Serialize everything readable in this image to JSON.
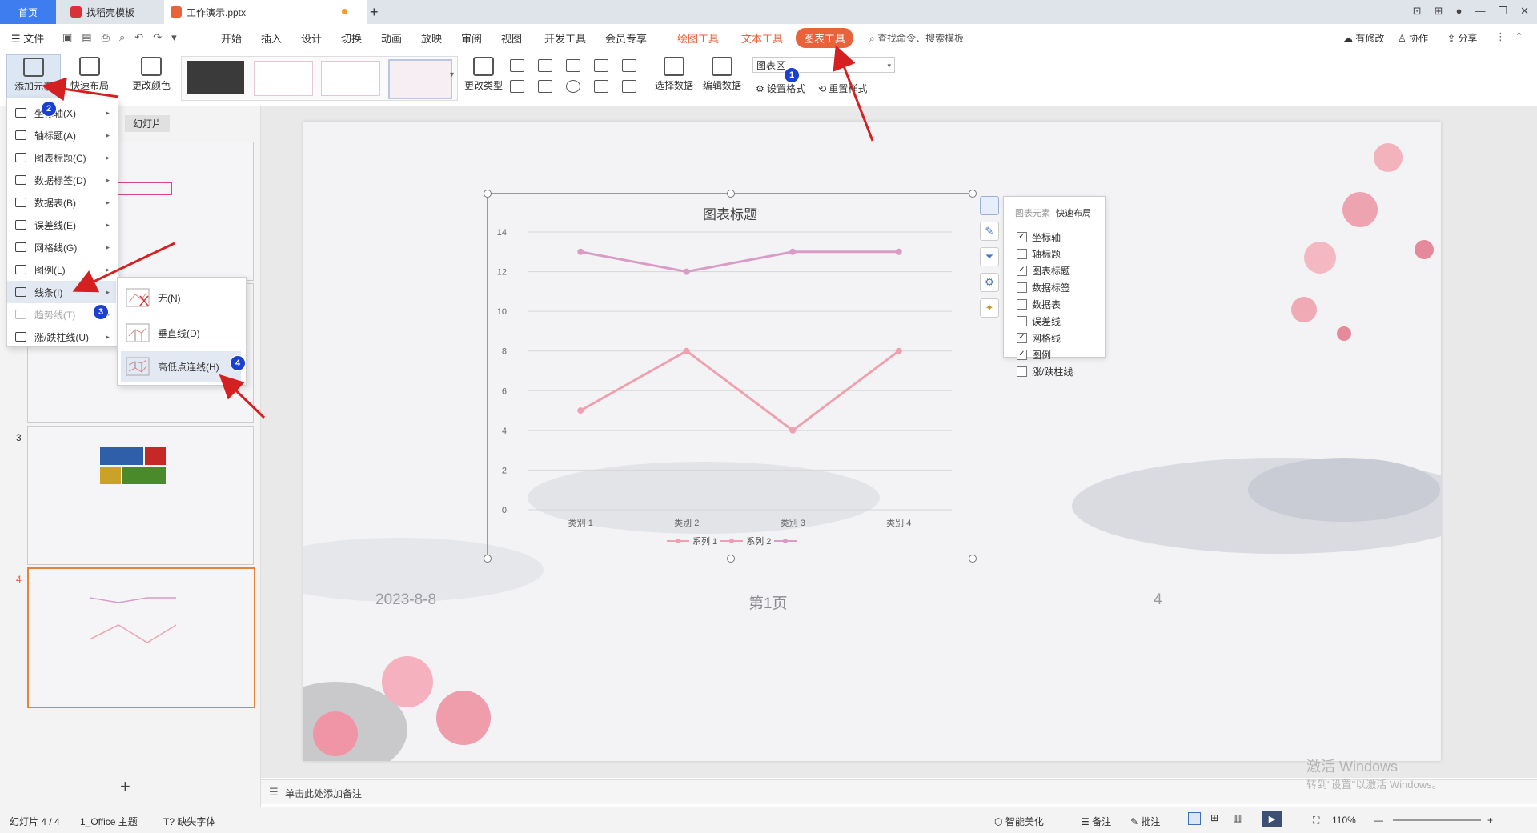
{
  "tabs": {
    "home": "首页",
    "template": "找稻壳模板",
    "doc": "工作演示.pptx",
    "new_tab": "+"
  },
  "menubar": {
    "file": "文件",
    "items": [
      "开始",
      "插入",
      "设计",
      "切换",
      "动画",
      "放映",
      "审阅",
      "视图",
      "开发工具",
      "会员专享"
    ],
    "tool_drawing": "绘图工具",
    "tool_text": "文本工具",
    "tool_chart": "图表工具",
    "search": "查找命令、搜索模板",
    "changes": "有修改",
    "collab": "协作",
    "share": "分享"
  },
  "ribbon": {
    "add_element": "添加元素",
    "quick_layout": "快速布局",
    "change_color": "更改颜色",
    "change_type": "更改类型",
    "select_data": "选择数据",
    "edit_data": "编辑数据",
    "chart_area_select": "图表区",
    "set_format": "设置格式",
    "reset_style": "重置样式"
  },
  "leftpane": {
    "slides_tab": "幻灯片",
    "slide3_num": "3",
    "slide4_num": "4",
    "add_slide": "+"
  },
  "add_element_menu": {
    "items": [
      {
        "label": "坐标轴(X)",
        "enabled": true
      },
      {
        "label": "轴标题(A)",
        "enabled": true
      },
      {
        "label": "图表标题(C)",
        "enabled": true
      },
      {
        "label": "数据标签(D)",
        "enabled": true
      },
      {
        "label": "数据表(B)",
        "enabled": true
      },
      {
        "label": "误差线(E)",
        "enabled": true
      },
      {
        "label": "网格线(G)",
        "enabled": true
      },
      {
        "label": "图例(L)",
        "enabled": true
      },
      {
        "label": "线条(I)",
        "enabled": true
      },
      {
        "label": "趋势线(T)",
        "enabled": false
      },
      {
        "label": "涨/跌柱线(U)",
        "enabled": true
      }
    ]
  },
  "lines_submenu": {
    "none": "无(N)",
    "drop_lines": "垂直线(D)",
    "high_low": "高低点连线(H)"
  },
  "badges": [
    "1",
    "2",
    "3",
    "4"
  ],
  "slide": {
    "date": "2023-8-8",
    "page": "第1页",
    "number": "4"
  },
  "chart_data": {
    "type": "line",
    "title": "图表标题",
    "categories": [
      "类别 1",
      "类别 2",
      "类别 3",
      "类别 4"
    ],
    "series": [
      {
        "name": "系列 1",
        "values": [
          5,
          8,
          4,
          8
        ],
        "color": "#f0a1b0"
      },
      {
        "name": "系列 2",
        "values": [
          13,
          12,
          13,
          13
        ],
        "color": "#d99cc6"
      }
    ],
    "ylim": [
      0,
      14
    ],
    "yticks": [
      0,
      2,
      4,
      6,
      8,
      10,
      12,
      14
    ],
    "grid": true,
    "legend": "bottom"
  },
  "element_panel": {
    "tab_elements": "图表元素",
    "tab_layout": "快速布局",
    "items": [
      {
        "label": "坐标轴",
        "checked": true
      },
      {
        "label": "轴标题",
        "checked": false
      },
      {
        "label": "图表标题",
        "checked": true
      },
      {
        "label": "数据标签",
        "checked": false
      },
      {
        "label": "数据表",
        "checked": false
      },
      {
        "label": "误差线",
        "checked": false
      },
      {
        "label": "网格线",
        "checked": true
      },
      {
        "label": "图例",
        "checked": true
      },
      {
        "label": "涨/跌柱线",
        "checked": false
      }
    ]
  },
  "notes_placeholder": "单击此处添加备注",
  "watermark": {
    "line1": "激活 Windows",
    "line2": "转到\"设置\"以激活 Windows。"
  },
  "statusbar": {
    "slide_count": "幻灯片 4 / 4",
    "theme": "1_Office 主题",
    "missing_font": "缺失字体",
    "smart": "智能美化",
    "notes": "备注",
    "comments": "批注",
    "zoom": "110%"
  },
  "colors": {
    "accent": "#e8623a",
    "badge": "#1a3fd3",
    "arrow": "#d42020"
  }
}
